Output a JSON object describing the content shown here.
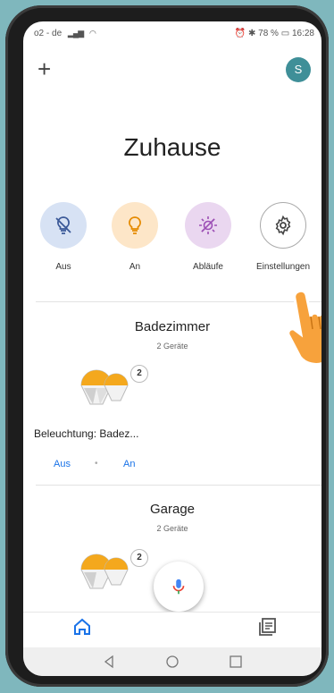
{
  "status_bar": {
    "carrier": "o2 - de",
    "right_text": "78 %",
    "time": "16:28"
  },
  "header": {
    "add_icon": "plus-icon",
    "avatar_letter": "S",
    "title": "Zuhause"
  },
  "quick_actions": [
    {
      "label": "Aus",
      "icon": "lightbulb-off-icon",
      "color": "#d7e2f4"
    },
    {
      "label": "An",
      "icon": "lightbulb-icon",
      "color": "#fde6c8"
    },
    {
      "label": "Abläufe",
      "icon": "routine-sun-icon",
      "color": "#ead7f0"
    },
    {
      "label": "Einstellungen",
      "icon": "gear-icon",
      "color": "#ffffff"
    }
  ],
  "rooms": [
    {
      "name": "Badezimmer",
      "device_count": "2 Geräte",
      "bulb_count": "2",
      "device_label": "Beleuchtung: Badez...",
      "off_label": "Aus",
      "on_label": "An"
    },
    {
      "name": "Garage",
      "device_count": "2 Geräte",
      "bulb_count": "2"
    }
  ],
  "bottom_nav": {
    "home_icon": "home-icon",
    "feed_icon": "feed-icon"
  },
  "colors": {
    "accent": "#1a73e8",
    "avatar": "#3f8f98",
    "bulb": "#f4a81d"
  }
}
